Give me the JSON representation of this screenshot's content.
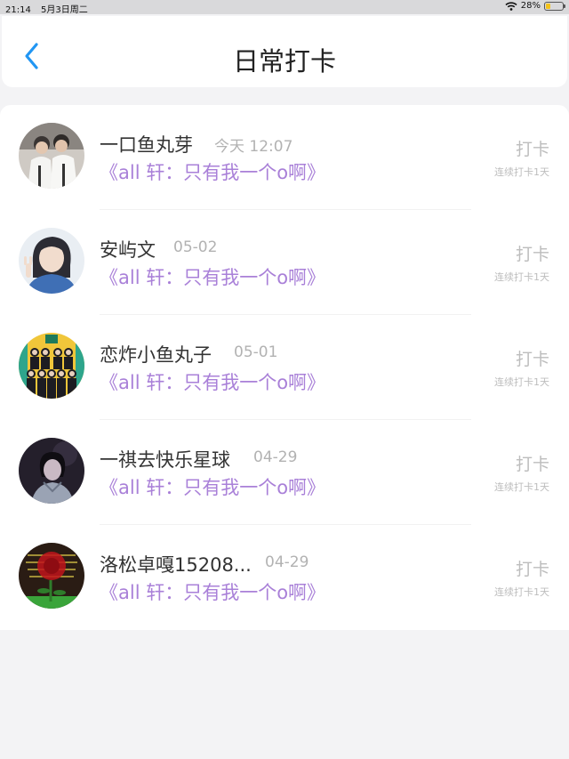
{
  "status_bar": {
    "time": "21:14",
    "date": "5月3日周二",
    "battery": "28%",
    "battery_level": 0.28
  },
  "header": {
    "title": "日常打卡",
    "back_icon": "chevron-left-icon"
  },
  "colors": {
    "accent": "#2196f3",
    "book_title": "#a980d8",
    "muted": "#b2b2b2"
  },
  "entries": [
    {
      "name": "一口鱼丸芽",
      "date": "今天 12:07",
      "book": "《all 轩：只有我一个o啊》",
      "checkin": "打卡",
      "streak": "连续打卡1天",
      "avatar": "avatar-two-boys"
    },
    {
      "name": "安屿文",
      "date": "05-02",
      "book": "《all 轩：只有我一个o啊》",
      "checkin": "打卡",
      "streak": "连续打卡1天",
      "avatar": "avatar-girl-peace"
    },
    {
      "name": "恋炸小鱼丸子",
      "date": "05-01",
      "book": "《all 轩：只有我一个o啊》",
      "checkin": "打卡",
      "streak": "连续打卡1天",
      "avatar": "avatar-group"
    },
    {
      "name": "一祺去快乐星球",
      "date": "04-29",
      "book": "《all 轩：只有我一个o啊》",
      "checkin": "打卡",
      "streak": "连续打卡1天",
      "avatar": "avatar-dark-portrait"
    },
    {
      "name": "洛松卓嘎15208...",
      "date": "04-29",
      "book": "《all 轩：只有我一个o啊》",
      "checkin": "打卡",
      "streak": "连续打卡1天",
      "avatar": "avatar-red-rose"
    }
  ]
}
